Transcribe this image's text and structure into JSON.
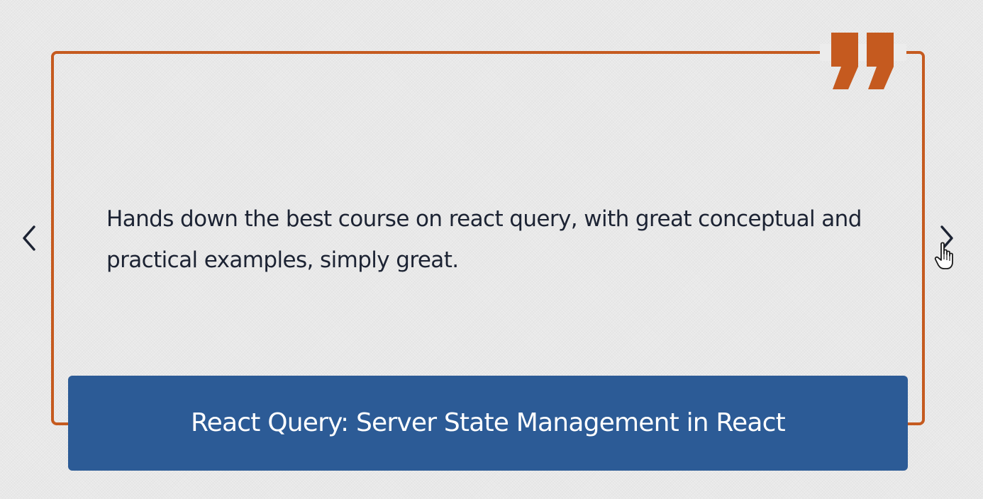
{
  "testimonial": {
    "quote": "Hands down the best course on react query, with great conceptual and practical examples, simply great.",
    "course_title": "React Query: Server State Management in React"
  },
  "navigation": {
    "prev_icon": "chevron-left-icon",
    "next_icon": "chevron-right-icon"
  },
  "icons": {
    "quote": "quote-mark-icon",
    "cursor": "pointer-hand-cursor-icon"
  },
  "colors": {
    "accent": "#c55a1f",
    "banner": "#2c5b96",
    "text": "#1c2333",
    "background": "#ececec"
  }
}
